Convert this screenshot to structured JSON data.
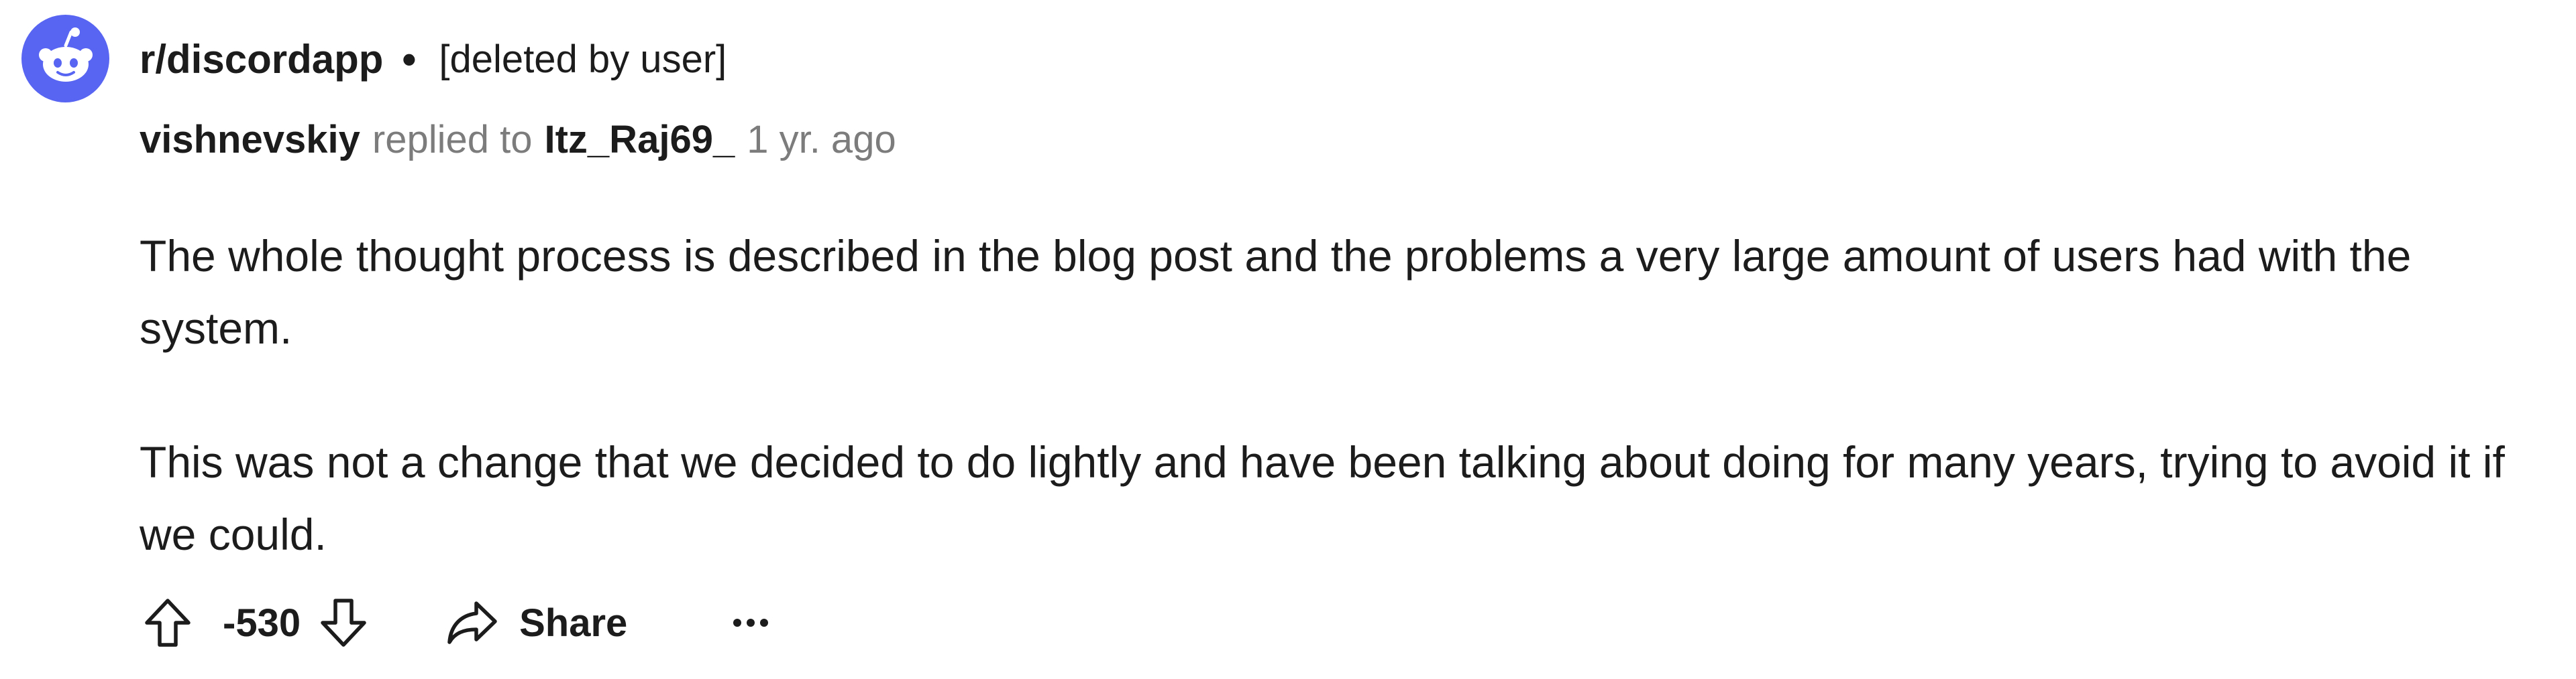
{
  "header": {
    "subreddit": "r/discordapp",
    "separator": "•",
    "post_author": "[deleted by user]"
  },
  "comment": {
    "author": "vishnevskiy",
    "replied_to_label": "replied to",
    "parent_author": "Itz_Raj69_",
    "timestamp": "1 yr. ago",
    "paragraphs": [
      "The whole thought process is described in the blog post and the problems a very large amount of users had with the system.",
      "This was not a change that we decided to do lightly and have been talking about doing for many years, trying to avoid it if we could."
    ]
  },
  "actions": {
    "score": "-530",
    "share_label": "Share"
  },
  "colors": {
    "avatar_bg": "#5865f2",
    "text": "#1c1c1c",
    "muted": "#7c7c7c"
  },
  "icons": {
    "avatar": "discord-logo-icon",
    "upvote": "upvote-arrow-icon",
    "downvote": "downvote-arrow-icon",
    "share": "share-arrow-icon",
    "more": "more-options-icon"
  }
}
